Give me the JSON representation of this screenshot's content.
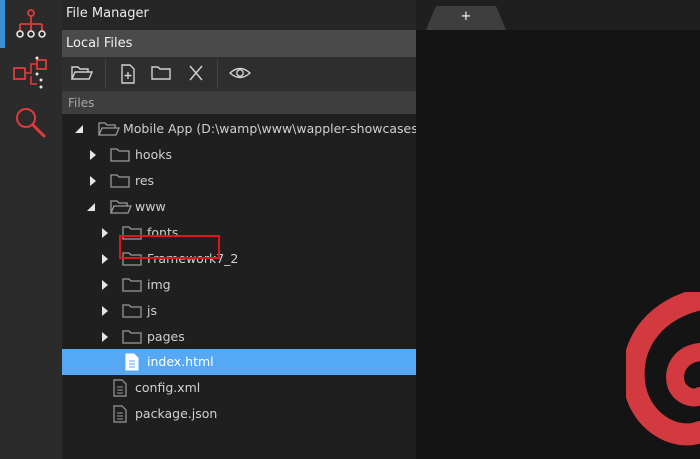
{
  "rail": {
    "items": [
      {
        "icon": "sitemap-icon",
        "active": true
      },
      {
        "icon": "workflow-icon",
        "active": false
      },
      {
        "icon": "search-icon",
        "active": false
      }
    ]
  },
  "file_manager": {
    "title": "File Manager",
    "section": "Local Files",
    "toolbar": [
      "open-folder-icon",
      "new-file-icon",
      "new-folder-icon",
      "delete-icon",
      "preview-icon"
    ],
    "files_label": "Files"
  },
  "tree": [
    {
      "label": "Mobile App (D:\\wamp\\www\\wappler-showcases\\m",
      "type": "folder",
      "expanded": true,
      "depth": 0
    },
    {
      "label": "hooks",
      "type": "folder",
      "expanded": false,
      "depth": 1
    },
    {
      "label": "res",
      "type": "folder",
      "expanded": false,
      "depth": 1
    },
    {
      "label": "www",
      "type": "folder",
      "expanded": true,
      "depth": 1
    },
    {
      "label": "fonts",
      "type": "folder",
      "expanded": false,
      "depth": 2
    },
    {
      "label": "Framework7_2",
      "type": "folder",
      "expanded": false,
      "depth": 2
    },
    {
      "label": "img",
      "type": "folder",
      "expanded": false,
      "depth": 2
    },
    {
      "label": "js",
      "type": "folder",
      "expanded": false,
      "depth": 2
    },
    {
      "label": "pages",
      "type": "folder",
      "expanded": false,
      "depth": 2
    },
    {
      "label": "index.html",
      "type": "file",
      "selected": true,
      "depth": 2
    },
    {
      "label": "config.xml",
      "type": "file",
      "depth": 1
    },
    {
      "label": "package.json",
      "type": "file",
      "depth": 1
    }
  ],
  "editor": {
    "new_tab_label": "+"
  },
  "colors": {
    "accent": "#55a8f4",
    "highlight": "#e0141e",
    "logo": "#d33a3f"
  }
}
